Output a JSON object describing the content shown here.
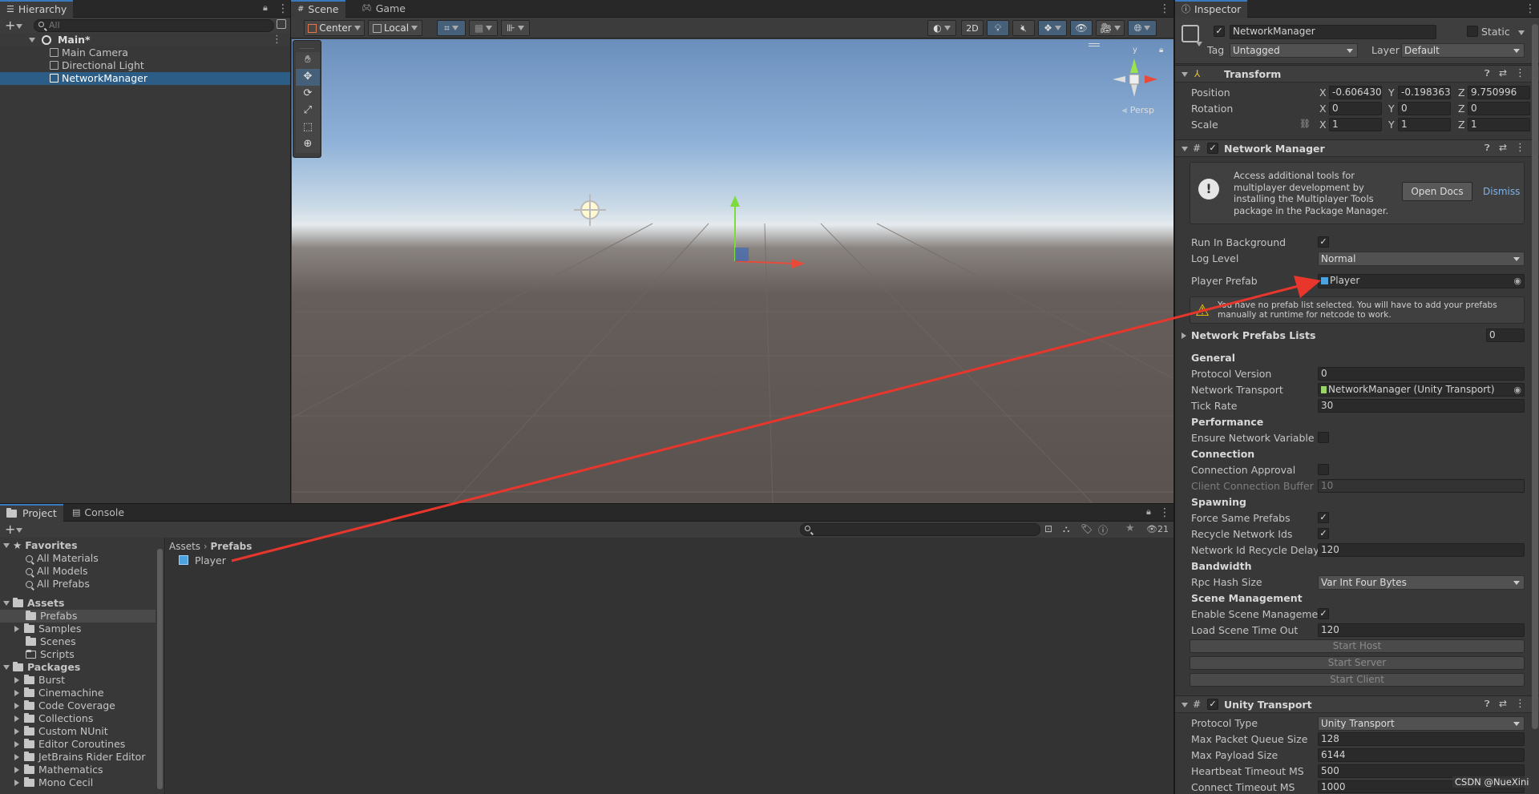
{
  "hierarchy": {
    "tab": "Hierarchy",
    "search_placeholder": "All",
    "scene": "Main*",
    "items": [
      "Main Camera",
      "Directional Light",
      "NetworkManager"
    ]
  },
  "scene_view": {
    "tabs": [
      "Scene",
      "Game"
    ],
    "pivot": "Center",
    "space": "Local",
    "mode_2d": "2D",
    "persp": "Persp",
    "axis_y": "y"
  },
  "project": {
    "tabs": [
      "Project",
      "Console"
    ],
    "breadcrumb": [
      "Assets",
      "Prefabs"
    ],
    "hidden_count": "21",
    "asset": "Player",
    "favorites_label": "Favorites",
    "favorites": [
      "All Materials",
      "All Models",
      "All Prefabs"
    ],
    "assets_label": "Assets",
    "assets": [
      "Prefabs",
      "Samples",
      "Scenes",
      "Scripts"
    ],
    "packages_label": "Packages",
    "packages": [
      "Burst",
      "Cinemachine",
      "Code Coverage",
      "Collections",
      "Custom NUnit",
      "Editor Coroutines",
      "JetBrains Rider Editor",
      "Mathematics",
      "Mono Cecil"
    ]
  },
  "inspector": {
    "tab": "Inspector",
    "object_name": "NetworkManager",
    "static_label": "Static",
    "tag_label": "Tag",
    "tag_value": "Untagged",
    "layer_label": "Layer",
    "layer_value": "Default",
    "transform": {
      "title": "Transform",
      "position_label": "Position",
      "rotation_label": "Rotation",
      "scale_label": "Scale",
      "x": "X",
      "y": "Y",
      "z": "Z",
      "position": [
        "-0.606430",
        "-0.198363",
        "9.750996"
      ],
      "rotation": [
        "0",
        "0",
        "0"
      ],
      "scale": [
        "1",
        "1",
        "1"
      ]
    },
    "network_manager": {
      "title": "Network Manager",
      "info_text": "Access additional tools for multiplayer development by installing the Multiplayer Tools package in the Package Manager.",
      "open_docs": "Open Docs",
      "dismiss": "Dismiss",
      "run_in_background": "Run In Background",
      "log_level_label": "Log Level",
      "log_level": "Normal",
      "player_prefab_label": "Player Prefab",
      "player_prefab": "Player",
      "warning_text": "You have no prefab list selected. You will have to add your prefabs manually at runtime for netcode to work.",
      "prefabs_lists_label": "Network Prefabs Lists",
      "prefabs_lists_count": "0",
      "general": "General",
      "protocol_version_label": "Protocol Version",
      "protocol_version": "0",
      "network_transport_label": "Network Transport",
      "network_transport": "NetworkManager (Unity Transport)",
      "tick_rate_label": "Tick Rate",
      "tick_rate": "30",
      "performance": "Performance",
      "ensure_var_label": "Ensure Network Variable Ler",
      "connection": "Connection",
      "connection_approval_label": "Connection Approval",
      "client_buffer_label": "Client Connection Buffer Tir",
      "client_buffer": "10",
      "spawning": "Spawning",
      "force_same_label": "Force Same Prefabs",
      "recycle_ids_label": "Recycle Network Ids",
      "recycle_delay_label": "Network Id Recycle Delay",
      "recycle_delay": "120",
      "bandwidth": "Bandwidth",
      "rpc_hash_label": "Rpc Hash Size",
      "rpc_hash": "Var Int Four Bytes",
      "scene_management": "Scene Management",
      "enable_scene_label": "Enable Scene Management",
      "load_timeout_label": "Load Scene Time Out",
      "load_timeout": "120",
      "start_host": "Start Host",
      "start_server": "Start Server",
      "start_client": "Start Client"
    },
    "unity_transport": {
      "title": "Unity Transport",
      "protocol_type_label": "Protocol Type",
      "protocol_type": "Unity Transport",
      "max_queue_label": "Max Packet Queue Size",
      "max_queue": "128",
      "max_payload_label": "Max Payload Size",
      "max_payload": "6144",
      "heartbeat_label": "Heartbeat Timeout MS",
      "heartbeat": "500",
      "connect_timeout_label": "Connect Timeout MS",
      "connect_timeout": "1000"
    }
  },
  "watermark": "CSDN @NueXini",
  "colors": {
    "selection": "#2c5d87",
    "arrow": "#e8362d",
    "sky_top": "#7fa6cf",
    "ground": "#5b534f"
  }
}
